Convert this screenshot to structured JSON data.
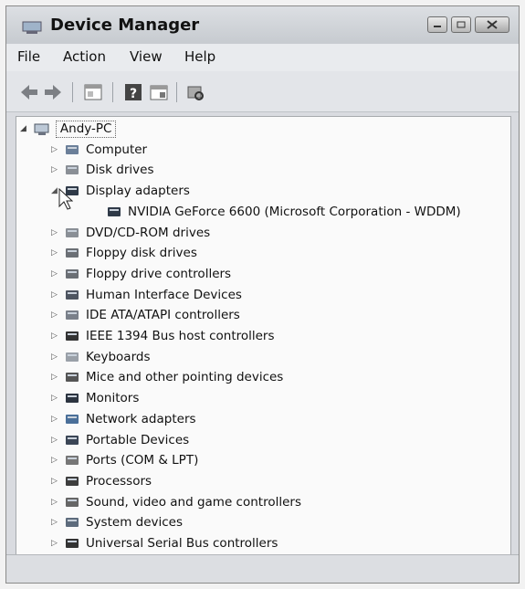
{
  "window": {
    "title": "Device Manager"
  },
  "menu": [
    "File",
    "Action",
    "View",
    "Help"
  ],
  "toolbar": [
    "back-icon",
    "forward-icon",
    "properties-icon",
    "help-icon",
    "show-hidden-icon",
    "scan-hardware-icon"
  ],
  "tree": {
    "root": "Andy-PC",
    "nodes": [
      {
        "label": "Computer",
        "icon": "computer-icon",
        "expanded": false
      },
      {
        "label": "Disk drives",
        "icon": "disk-drive-icon",
        "expanded": false
      },
      {
        "label": "Display adapters",
        "icon": "display-adapter-icon",
        "expanded": true,
        "children": [
          {
            "label": "NVIDIA GeForce 6600 (Microsoft Corporation - WDDM)",
            "icon": "display-adapter-icon"
          }
        ]
      },
      {
        "label": "DVD/CD-ROM drives",
        "icon": "dvd-drive-icon",
        "expanded": false
      },
      {
        "label": "Floppy disk drives",
        "icon": "floppy-drive-icon",
        "expanded": false
      },
      {
        "label": "Floppy drive controllers",
        "icon": "floppy-controller-icon",
        "expanded": false
      },
      {
        "label": "Human Interface Devices",
        "icon": "hid-icon",
        "expanded": false
      },
      {
        "label": "IDE ATA/ATAPI controllers",
        "icon": "ide-controller-icon",
        "expanded": false
      },
      {
        "label": "IEEE 1394 Bus host controllers",
        "icon": "ieee1394-icon",
        "expanded": false
      },
      {
        "label": "Keyboards",
        "icon": "keyboard-icon",
        "expanded": false
      },
      {
        "label": "Mice and other pointing devices",
        "icon": "mouse-icon",
        "expanded": false
      },
      {
        "label": "Monitors",
        "icon": "monitor-icon",
        "expanded": false
      },
      {
        "label": "Network adapters",
        "icon": "network-adapter-icon",
        "expanded": false
      },
      {
        "label": "Portable Devices",
        "icon": "portable-device-icon",
        "expanded": false
      },
      {
        "label": "Ports (COM & LPT)",
        "icon": "port-icon",
        "expanded": false
      },
      {
        "label": "Processors",
        "icon": "processor-icon",
        "expanded": false
      },
      {
        "label": "Sound, video and game controllers",
        "icon": "sound-icon",
        "expanded": false
      },
      {
        "label": "System devices",
        "icon": "system-device-icon",
        "expanded": false
      },
      {
        "label": "Universal Serial Bus controllers",
        "icon": "usb-icon",
        "expanded": false
      }
    ]
  },
  "status": ""
}
